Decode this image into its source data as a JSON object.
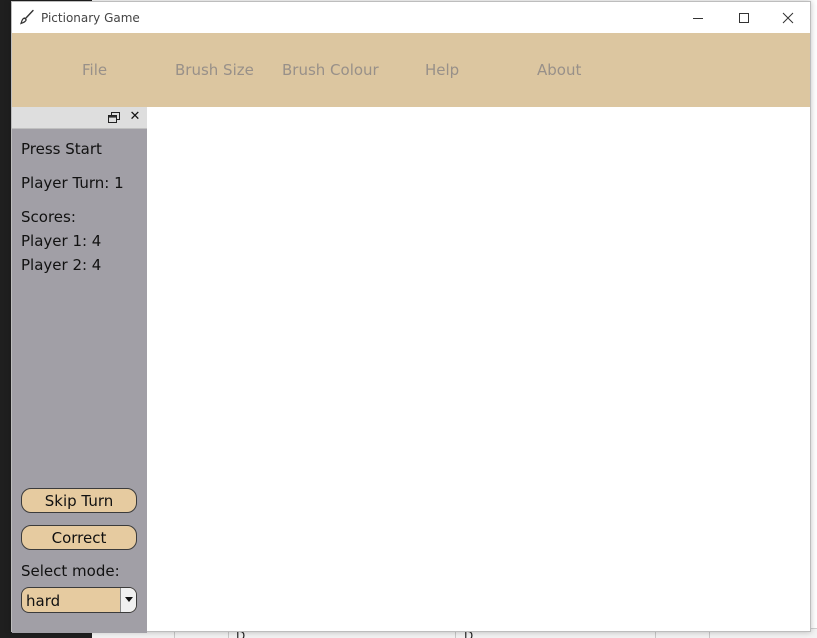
{
  "window": {
    "title": "Pictionary Game",
    "app_icon": "brush-icon"
  },
  "menu": {
    "items": [
      {
        "label": "File"
      },
      {
        "label": "Brush Size"
      },
      {
        "label": "Brush Colour"
      },
      {
        "label": "Help"
      },
      {
        "label": "About"
      }
    ]
  },
  "sidebar": {
    "status": "Press Start",
    "player_turn": "Player Turn: 1",
    "scores_label": "Scores:",
    "scores": [
      {
        "text": "Player 1: 4"
      },
      {
        "text": "Player 2: 4"
      }
    ],
    "skip_button": "Skip Turn",
    "correct_button": "Correct",
    "mode_label": "Select mode:",
    "mode_value": "hard"
  },
  "background": {
    "fragment_1": "D",
    "fragment_2": "D"
  },
  "colors": {
    "menubar": "#dcc6a0",
    "sidebar": "#a19fa6",
    "button": "#e6cba0",
    "menu_text": "#989089"
  }
}
